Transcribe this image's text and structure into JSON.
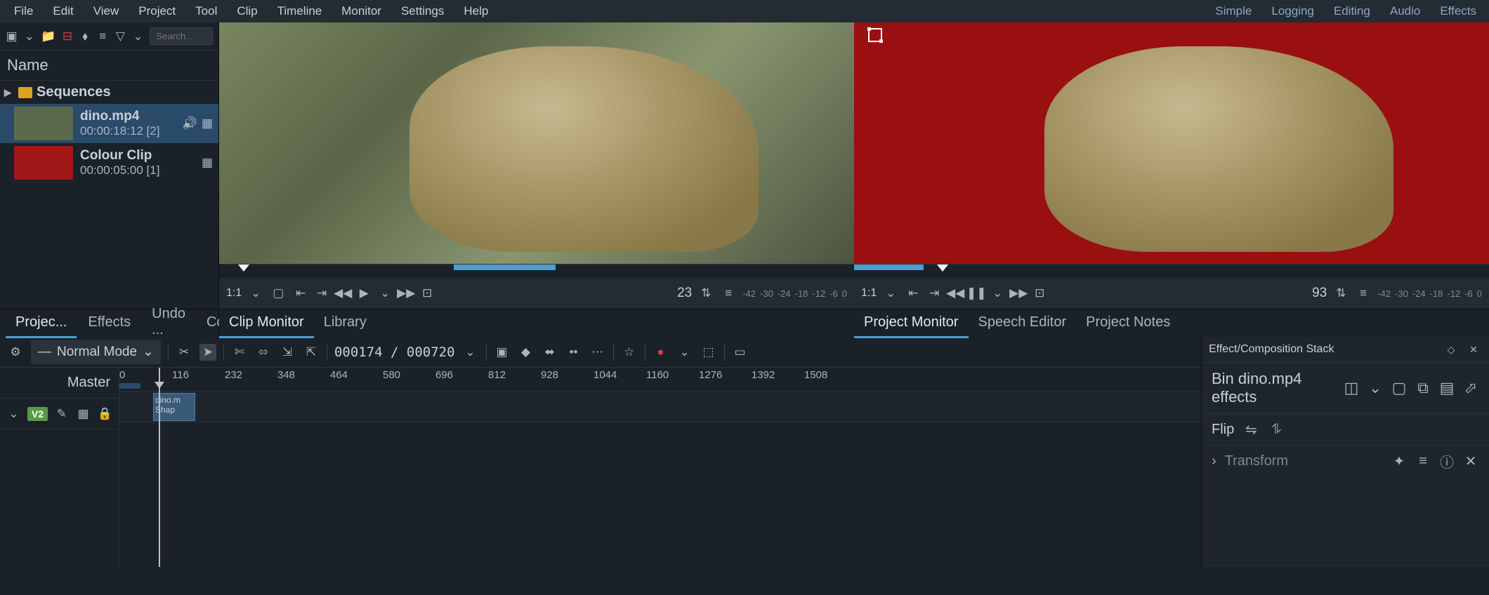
{
  "menu": {
    "items": [
      "File",
      "Edit",
      "View",
      "Project",
      "Tool",
      "Clip",
      "Timeline",
      "Monitor",
      "Settings",
      "Help"
    ],
    "workspaces": [
      "Simple",
      "Logging",
      "Editing",
      "Audio",
      "Effects"
    ]
  },
  "bin": {
    "search_placeholder": "Search...",
    "header": "Name",
    "sequences_label": "Sequences",
    "clips": [
      {
        "name": "dino.mp4",
        "duration": "00:00:18:12 [2]",
        "thumb": "video"
      },
      {
        "name": "Colour Clip",
        "duration": "00:00:05:00 [1]",
        "thumb": "red"
      }
    ]
  },
  "bin_tabs": [
    "Projec...",
    "Effects",
    "Undo ...",
    "Co"
  ],
  "clip_monitor": {
    "ratio": "1:1",
    "frame": "23",
    "db": [
      "-42",
      "-30",
      "-24",
      "-18",
      "-12",
      "-6",
      "0"
    ],
    "tabs": [
      "Clip Monitor",
      "Library"
    ]
  },
  "project_monitor": {
    "ratio": "1:1",
    "frame": "93",
    "db": [
      "-42",
      "-30",
      "-24",
      "-18",
      "-12",
      "-6",
      "0"
    ],
    "tabs": [
      "Project Monitor",
      "Speech Editor",
      "Project Notes"
    ]
  },
  "timeline": {
    "mode": "Normal Mode",
    "timecode": "000174 / 000720",
    "master": "Master",
    "ticks": [
      "0",
      "116",
      "232",
      "348",
      "464",
      "580",
      "696",
      "812",
      "928",
      "1044",
      "1160",
      "1276",
      "1392",
      "1508"
    ],
    "tracks": [
      {
        "name": "V2"
      }
    ],
    "clip_label": "dino.m\nShap"
  },
  "effects": {
    "header": "Effect/Composition Stack",
    "title": "Bin dino.mp4 effects",
    "flip": "Flip",
    "transform": "Transform"
  }
}
